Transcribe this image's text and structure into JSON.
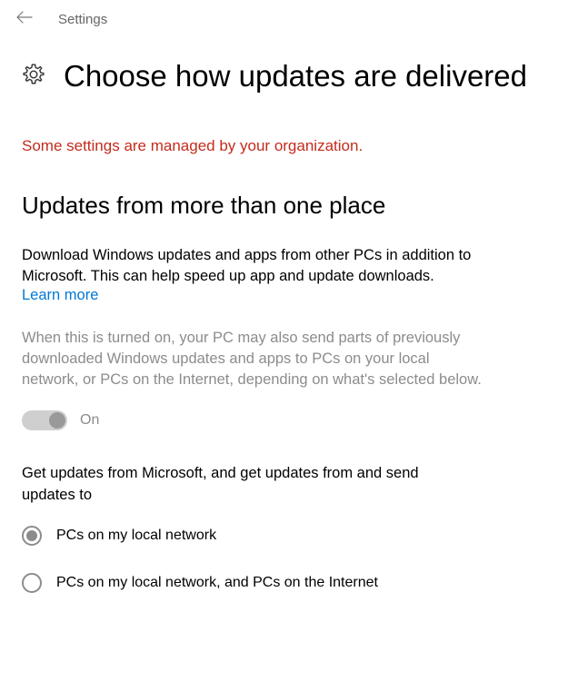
{
  "header": {
    "back_label": "Back",
    "title": "Settings"
  },
  "page": {
    "title": "Choose how updates are delivered",
    "org_notice": "Some settings are managed by your organization."
  },
  "section": {
    "title": "Updates from more than one place",
    "description": "Download Windows updates and apps from other PCs in addition to Microsoft. This can help speed up app and update downloads.",
    "learn_more": "Learn more",
    "info": "When this is turned on, your PC may also send parts of previously downloaded Windows updates and apps to PCs on your local network, or PCs on the Internet, depending on what's selected below.",
    "toggle_state": "On",
    "subhead": "Get updates from Microsoft, and get updates from and send updates to",
    "options": [
      {
        "label": "PCs on my local network",
        "selected": true
      },
      {
        "label": "PCs on my local network, and PCs on the Internet",
        "selected": false
      }
    ]
  }
}
